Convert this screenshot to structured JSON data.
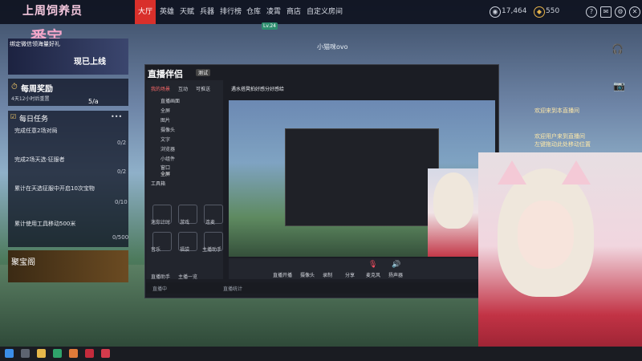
{
  "topbar": {
    "logo": "上周饲养员",
    "logo_sub": "番宝",
    "menu": [
      "大厅",
      "英雄",
      "天赋",
      "兵器",
      "排行榜",
      "仓库",
      "凌霄",
      "商店",
      "自定义房间"
    ],
    "active_menu": "大厅",
    "online_badge": "Lv.24",
    "stat1": "17,464",
    "stat2": "550"
  },
  "left_panel": {
    "bind_label": "绑定微信领海量好礼",
    "banner_text": "现已上线",
    "weekly_reward_title": "每周奖励",
    "weekly_reward_time": "4天12小时后重置",
    "weekly_reward_progress": "5/a",
    "daily_tasks_title": "每日任务",
    "daily_tasks_more": "•••",
    "tasks": [
      {
        "label": "完成任意2场对局",
        "count": "0/2"
      },
      {
        "label": "完成2场天选·征服者",
        "count": "0/2"
      },
      {
        "label": "累计在天选征服中开启10次宝物",
        "count": "0/10"
      },
      {
        "label": "累计使用工具移动500米",
        "count": "0/500"
      }
    ],
    "treasure_title": "聚宝阁"
  },
  "stream": {
    "app_name": "直播伴侣",
    "app_badge": "测试",
    "header_title": "小猫咪ovo",
    "stream_title": "遇水搭凳拍好感分好感给",
    "tabs": [
      "我的场景",
      "互动",
      "可推送"
    ],
    "scene_items": [
      "直播画面",
      "全屏",
      "图片",
      "摄像头",
      "文字",
      "浏览器",
      "小组件",
      "窗口",
      "全屏"
    ],
    "tool_label": "工具箱",
    "tools_row1": [
      "迷你计时",
      "游戏",
      "连麦"
    ],
    "tools_row2": [
      "音乐",
      "福袋",
      "主播助手"
    ],
    "tools_row3": [
      "直播助手",
      "主播一览"
    ],
    "bottom_tools": [
      "直播开播",
      "摄像头",
      "录制",
      "分享",
      "麦克风",
      "扬声器"
    ],
    "status_text": "直播中",
    "status_more": "直播统计"
  },
  "chat": {
    "messages": [
      "欢迎用户来到直播间",
      "左键拖动此处移动位置",
      "欢迎来到本直播间"
    ]
  },
  "taskbar": {
    "icons": [
      "windows-icon",
      "search-icon",
      "files-icon",
      "browser-icon",
      "app-icon-1",
      "app-icon-2",
      "app-icon-3"
    ]
  }
}
